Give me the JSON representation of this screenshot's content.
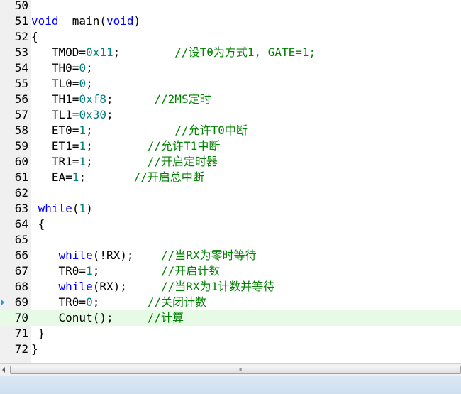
{
  "editor": {
    "current_line": "70",
    "breakpoint_marker_icon": "arrow-marker-icon",
    "lines": [
      {
        "num": "50",
        "segments": []
      },
      {
        "num": "51",
        "segments": [
          {
            "t": "kw",
            "v": "void"
          },
          {
            "t": "pl",
            "v": "  main("
          },
          {
            "t": "kw",
            "v": "void"
          },
          {
            "t": "pl",
            "v": ")"
          }
        ]
      },
      {
        "num": "52",
        "segments": [
          {
            "t": "pl",
            "v": "{"
          }
        ]
      },
      {
        "num": "53",
        "segments": [
          {
            "t": "pl",
            "v": "   TMOD="
          },
          {
            "t": "num",
            "v": "0x11"
          },
          {
            "t": "pl",
            "v": ";        "
          },
          {
            "t": "cm",
            "v": "//设T0为方式1, GATE=1;"
          }
        ]
      },
      {
        "num": "54",
        "segments": [
          {
            "t": "pl",
            "v": "   TH0="
          },
          {
            "t": "num",
            "v": "0"
          },
          {
            "t": "pl",
            "v": ";"
          }
        ]
      },
      {
        "num": "55",
        "segments": [
          {
            "t": "pl",
            "v": "   TL0="
          },
          {
            "t": "num",
            "v": "0"
          },
          {
            "t": "pl",
            "v": ";"
          }
        ]
      },
      {
        "num": "56",
        "segments": [
          {
            "t": "pl",
            "v": "   TH1="
          },
          {
            "t": "num",
            "v": "0xf8"
          },
          {
            "t": "pl",
            "v": ";      "
          },
          {
            "t": "cm",
            "v": "//2MS定时"
          }
        ]
      },
      {
        "num": "57",
        "segments": [
          {
            "t": "pl",
            "v": "   TL1="
          },
          {
            "t": "num",
            "v": "0x30"
          },
          {
            "t": "pl",
            "v": ";"
          }
        ]
      },
      {
        "num": "58",
        "segments": [
          {
            "t": "pl",
            "v": "   ET0="
          },
          {
            "t": "num",
            "v": "1"
          },
          {
            "t": "pl",
            "v": ";            "
          },
          {
            "t": "cm",
            "v": "//允许T0中断"
          }
        ]
      },
      {
        "num": "59",
        "segments": [
          {
            "t": "pl",
            "v": "   ET1="
          },
          {
            "t": "num",
            "v": "1"
          },
          {
            "t": "pl",
            "v": ";        "
          },
          {
            "t": "cm",
            "v": "//允许T1中断"
          }
        ]
      },
      {
        "num": "60",
        "segments": [
          {
            "t": "pl",
            "v": "   TR1="
          },
          {
            "t": "num",
            "v": "1"
          },
          {
            "t": "pl",
            "v": ";        "
          },
          {
            "t": "cm",
            "v": "//开启定时器"
          }
        ]
      },
      {
        "num": "61",
        "segments": [
          {
            "t": "pl",
            "v": "   EA="
          },
          {
            "t": "num",
            "v": "1"
          },
          {
            "t": "pl",
            "v": ";       "
          },
          {
            "t": "cm",
            "v": "//开启总中断"
          }
        ]
      },
      {
        "num": "62",
        "segments": []
      },
      {
        "num": "63",
        "segments": [
          {
            "t": "pl",
            "v": " "
          },
          {
            "t": "kw",
            "v": "while"
          },
          {
            "t": "pl",
            "v": "("
          },
          {
            "t": "num",
            "v": "1"
          },
          {
            "t": "pl",
            "v": ")"
          }
        ]
      },
      {
        "num": "64",
        "segments": [
          {
            "t": "pl",
            "v": " {"
          }
        ]
      },
      {
        "num": "65",
        "segments": []
      },
      {
        "num": "66",
        "segments": [
          {
            "t": "pl",
            "v": "    "
          },
          {
            "t": "kw",
            "v": "while"
          },
          {
            "t": "pl",
            "v": "(!RX);    "
          },
          {
            "t": "cm",
            "v": "//当RX为零时等待"
          }
        ]
      },
      {
        "num": "67",
        "segments": [
          {
            "t": "pl",
            "v": "    TR0="
          },
          {
            "t": "num",
            "v": "1"
          },
          {
            "t": "pl",
            "v": ";         "
          },
          {
            "t": "cm",
            "v": "//开启计数"
          }
        ]
      },
      {
        "num": "68",
        "segments": [
          {
            "t": "pl",
            "v": "    "
          },
          {
            "t": "kw",
            "v": "while"
          },
          {
            "t": "pl",
            "v": "(RX);     "
          },
          {
            "t": "cm",
            "v": "//当RX为1计数并等待"
          }
        ]
      },
      {
        "num": "69",
        "segments": [
          {
            "t": "pl",
            "v": "    TR0="
          },
          {
            "t": "num",
            "v": "0"
          },
          {
            "t": "pl",
            "v": ";       "
          },
          {
            "t": "cm",
            "v": "//关闭计数"
          }
        ]
      },
      {
        "num": "70",
        "segments": [
          {
            "t": "pl",
            "v": "    Conut();     "
          },
          {
            "t": "cm",
            "v": "//计算"
          }
        ]
      },
      {
        "num": "71",
        "segments": [
          {
            "t": "pl",
            "v": " }"
          }
        ]
      },
      {
        "num": "72",
        "segments": [
          {
            "t": "pl",
            "v": "}"
          }
        ]
      }
    ]
  },
  "colors": {
    "keyword": "#0000ff",
    "number": "#008080",
    "comment": "#008000",
    "current_line_bg": "#e6fae6"
  },
  "scrollbar": {
    "grip_label": "III",
    "left_arrow_icon": "arrow-left-icon"
  }
}
